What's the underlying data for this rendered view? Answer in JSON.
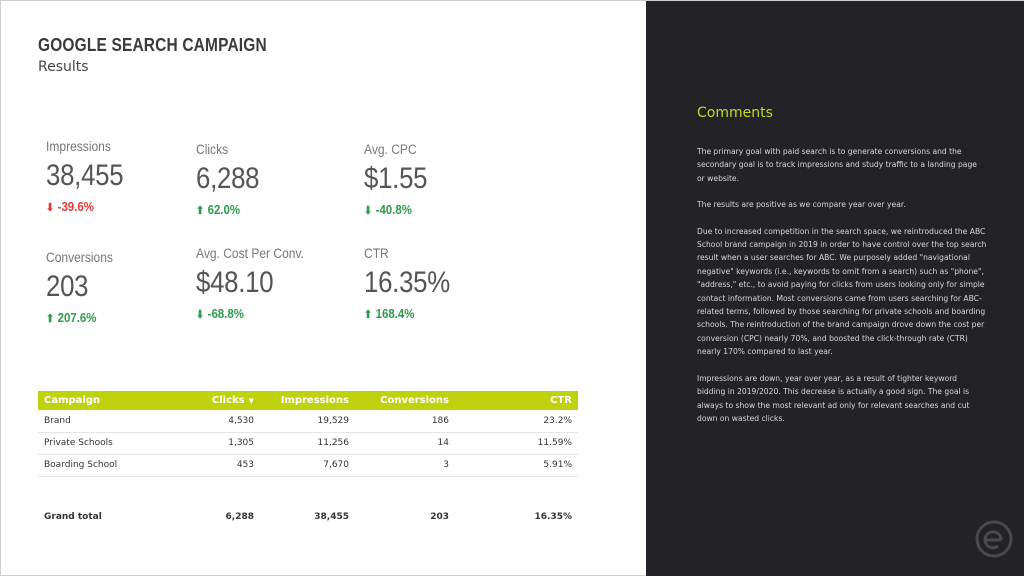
{
  "header": {
    "title": "GOOGLE SEARCH CAMPAIGN",
    "subtitle": "Results"
  },
  "kpis": [
    {
      "label": "Impressions",
      "value": "38,455",
      "delta": "-39.6%",
      "direction": "down",
      "color": "#e53935",
      "icon": "arrow-down-icon"
    },
    {
      "label": "Clicks",
      "value": "6,288",
      "delta": "62.0%",
      "direction": "up",
      "color": "#2e9a4a",
      "icon": "arrow-up-icon"
    },
    {
      "label": "Avg. CPC",
      "value": "$1.55",
      "delta": "-40.8%",
      "direction": "down",
      "color": "#2e9a4a",
      "icon": "arrow-down-icon"
    },
    {
      "label": "Conversions",
      "value": "203",
      "delta": "207.6%",
      "direction": "up",
      "color": "#2e9a4a",
      "icon": "arrow-up-icon"
    },
    {
      "label": "Avg. Cost Per Conv.",
      "value": "$48.10",
      "delta": "-68.8%",
      "direction": "down",
      "color": "#2e9a4a",
      "icon": "arrow-down-icon"
    },
    {
      "label": "CTR",
      "value": "16.35%",
      "delta": "168.4%",
      "direction": "up",
      "color": "#2e9a4a",
      "icon": "arrow-up-icon"
    }
  ],
  "table": {
    "header_color": "#c0d20d",
    "columns": [
      "Campaign",
      "Clicks",
      "Impressions",
      "Conversions",
      "CTR"
    ],
    "sort_icon": "sort-down-icon",
    "rows": [
      [
        "Brand",
        "4,530",
        "19,529",
        "186",
        "23.2%"
      ],
      [
        "Private Schools",
        "1,305",
        "11,256",
        "14",
        "11.59%"
      ],
      [
        "Boarding School",
        "453",
        "7,670",
        "3",
        "5.91%"
      ]
    ],
    "total": [
      "Grand total",
      "6,288",
      "38,455",
      "203",
      "16.35%"
    ]
  },
  "comments": {
    "title": "Comments",
    "title_color": "#c5d82a",
    "paragraphs": [
      "The primary goal with paid search is to generate conversions and the secondary goal is to track impressions and study traffic to a landing page or website.",
      "The results are positive as we compare year over year.",
      "Due to increased competition in the search space, we reintroduced the ABC School brand campaign in 2019 in order to have control over the top search result when a user searches for ABC. We purposely added \"navigational negative\" keywords (i.e., keywords to omit from a search) such as \"phone\", \"address,\" etc., to avoid paying for clicks from users looking only for simple contact information. Most conversions came from users searching for ABC-related terms, followed by those searching for private schools and boarding schools. The reintroduction of the brand campaign drove down the cost per conversion (CPC) nearly 70%, and boosted the click-through rate (CTR) nearly 170% compared to last year.",
      "Impressions are down, year over year, as a result of tighter keyword bidding in 2019/2020. This decrease is actually a good sign. The goal is always to show the most relevant ad only for relevant searches and cut down on wasted clicks."
    ]
  },
  "logo": {
    "icon": "brand-logo-icon"
  }
}
